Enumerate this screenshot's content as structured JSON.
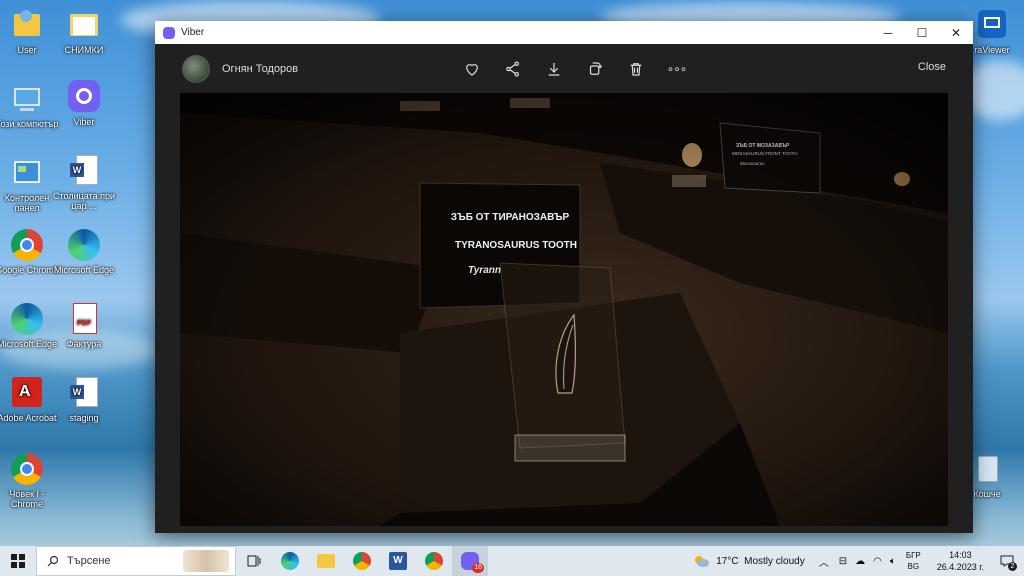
{
  "desktop": {
    "icons": [
      {
        "label": "User"
      },
      {
        "label": "СНИМКИ"
      },
      {
        "label": "Този компютър"
      },
      {
        "label": "Viber"
      },
      {
        "label": "Контролен панел"
      },
      {
        "label": "Столицата при цар ..."
      },
      {
        "label": "Google Chrome"
      },
      {
        "label": "Microsoft Edge"
      },
      {
        "label": "Microsoft Edge"
      },
      {
        "label": "Фактура"
      },
      {
        "label": "Adobe Acrobat"
      },
      {
        "label": "staging"
      },
      {
        "label": "Човек I - Chrome"
      },
      {
        "label": "raViewer"
      },
      {
        "label": "Кошче"
      }
    ]
  },
  "window": {
    "title": "Viber",
    "minimize": "─",
    "maximize": "☐",
    "close": "✕"
  },
  "viewer": {
    "sender": "Огнян Тодоров",
    "close_label": "Close",
    "tools": [
      "heart-icon",
      "share-icon",
      "download-icon",
      "rotate-icon",
      "trash-icon",
      "more-icon"
    ],
    "more_glyph": "∘∘∘",
    "photo_sign": {
      "line1": "ЗЪБ ОТ ТИРАНОЗАВЪР",
      "line2": "TYRANOSAURUS TOOTH",
      "line3": "Tyrann"
    },
    "photo_sign_small": {
      "line1": "ЗЪБ ОТ МОЗАЗАВЪР",
      "line2": "MOSASAURUS FRONT TOOTH",
      "line3": "Mosasaurus"
    }
  },
  "taskbar": {
    "search_placeholder": "Търсене",
    "viber_badge": "16",
    "weather": "17°C  Mostly cloudy",
    "lang_top": "БГР",
    "lang_bottom": "BG",
    "time": "14:03",
    "date": "26.4.2023 г.",
    "notifications": "2"
  },
  "colors": {
    "viber": "#7360f2",
    "window_bg": "#202020",
    "taskbar": "#dfe7ef"
  }
}
